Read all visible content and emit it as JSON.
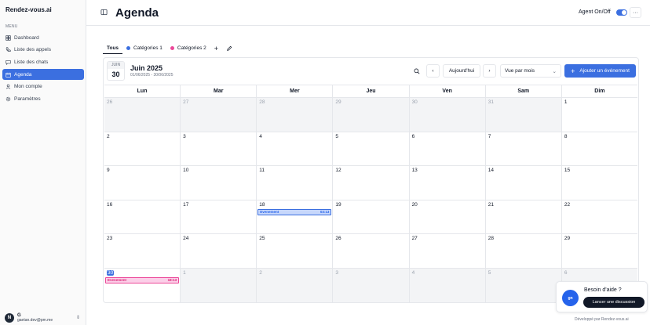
{
  "app": {
    "brand": "Rendez-vous.ai"
  },
  "sidebar": {
    "menu_title": "MENU",
    "items": [
      {
        "label": "Dashboard",
        "icon": "dashboard-icon",
        "active": false
      },
      {
        "label": "Liste des appels",
        "icon": "phone-icon",
        "active": false
      },
      {
        "label": "Liste des chats",
        "icon": "chat-icon",
        "active": false
      },
      {
        "label": "Agenda",
        "icon": "calendar-icon",
        "active": true
      },
      {
        "label": "Mon compte",
        "icon": "user-icon",
        "active": false
      },
      {
        "label": "Paramètres",
        "icon": "gear-icon",
        "active": false
      }
    ],
    "user": {
      "initial": "N",
      "name": "G",
      "email": "gaetan.dev@pm.me"
    }
  },
  "header": {
    "title": "Agenda",
    "agent_label": "Agent On/Off",
    "agent_on": true,
    "more_label": "···"
  },
  "tabs": {
    "items": [
      {
        "label": "Tous",
        "active": true,
        "color": ""
      },
      {
        "label": "Catégories 1",
        "active": false,
        "color": "#3b6fe0"
      },
      {
        "label": "Catégories 2",
        "active": false,
        "color": "#ec4899"
      }
    ],
    "add_label": "+"
  },
  "calendar": {
    "month_abbr": "JUIN",
    "day": "30",
    "month_title": "Juin 2025",
    "range": "01/06/2025 - 30/06/2025",
    "today_label": "Aujourd'hui",
    "view_label": "Vue par mois",
    "add_label": "Ajouter un événement",
    "weekdays": [
      "Lun",
      "Mar",
      "Mer",
      "Jeu",
      "Ven",
      "Sam",
      "Dim"
    ],
    "weeks": [
      [
        {
          "d": "26",
          "m": true
        },
        {
          "d": "27",
          "m": true
        },
        {
          "d": "28",
          "m": true
        },
        {
          "d": "29",
          "m": true
        },
        {
          "d": "30",
          "m": true
        },
        {
          "d": "31",
          "m": true
        },
        {
          "d": "1",
          "m": false
        }
      ],
      [
        {
          "d": "2",
          "m": false
        },
        {
          "d": "3",
          "m": false
        },
        {
          "d": "4",
          "m": false
        },
        {
          "d": "5",
          "m": false
        },
        {
          "d": "6",
          "m": false
        },
        {
          "d": "7",
          "m": false
        },
        {
          "d": "8",
          "m": false
        }
      ],
      [
        {
          "d": "9",
          "m": false
        },
        {
          "d": "10",
          "m": false
        },
        {
          "d": "11",
          "m": false
        },
        {
          "d": "12",
          "m": false
        },
        {
          "d": "13",
          "m": false
        },
        {
          "d": "14",
          "m": false
        },
        {
          "d": "15",
          "m": false
        }
      ],
      [
        {
          "d": "16",
          "m": false
        },
        {
          "d": "17",
          "m": false
        },
        {
          "d": "18",
          "m": false,
          "event": {
            "label": "Evenement",
            "time": "03:13",
            "color": "blue"
          }
        },
        {
          "d": "19",
          "m": false
        },
        {
          "d": "20",
          "m": false
        },
        {
          "d": "21",
          "m": false
        },
        {
          "d": "22",
          "m": false
        }
      ],
      [
        {
          "d": "23",
          "m": false
        },
        {
          "d": "24",
          "m": false
        },
        {
          "d": "25",
          "m": false
        },
        {
          "d": "26",
          "m": false
        },
        {
          "d": "27",
          "m": false
        },
        {
          "d": "28",
          "m": false
        },
        {
          "d": "29",
          "m": false
        }
      ],
      [
        {
          "d": "30",
          "m": false,
          "today": true,
          "event": {
            "label": "Evenement",
            "time": "18:13",
            "color": "pink"
          }
        },
        {
          "d": "1",
          "m": true
        },
        {
          "d": "2",
          "m": true
        },
        {
          "d": "3",
          "m": true
        },
        {
          "d": "4",
          "m": true
        },
        {
          "d": "5",
          "m": true
        },
        {
          "d": "6",
          "m": true
        }
      ]
    ]
  },
  "help": {
    "avatar": "gn",
    "title": "Besoin d'aide ?",
    "button": "Lancer une discussion"
  },
  "footer": {
    "credit": "Développé par Rendez-vous.ai"
  },
  "colors": {
    "accent": "#3b6fe0",
    "pink": "#ec4899"
  }
}
